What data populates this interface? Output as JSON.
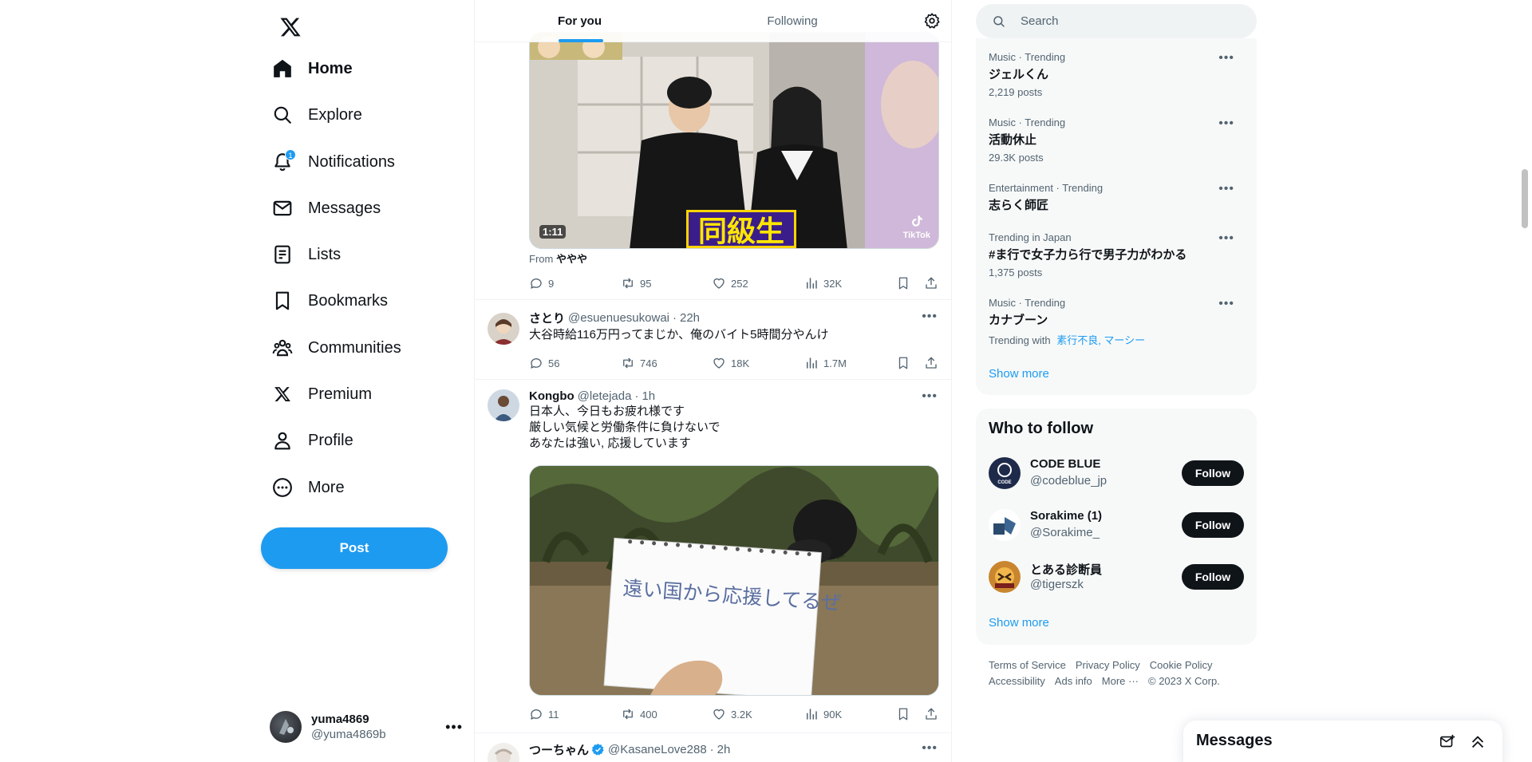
{
  "nav": {
    "items": [
      {
        "label": "Home",
        "icon": "home-icon"
      },
      {
        "label": "Explore",
        "icon": "search-icon"
      },
      {
        "label": "Notifications",
        "icon": "bell-icon",
        "badge": "1"
      },
      {
        "label": "Messages",
        "icon": "envelope-icon"
      },
      {
        "label": "Lists",
        "icon": "list-icon"
      },
      {
        "label": "Bookmarks",
        "icon": "bookmark-icon"
      },
      {
        "label": "Communities",
        "icon": "people-icon"
      },
      {
        "label": "Premium",
        "icon": "x-logo-icon"
      },
      {
        "label": "Profile",
        "icon": "person-icon"
      },
      {
        "label": "More",
        "icon": "more-circle-icon"
      }
    ],
    "post_label": "Post"
  },
  "account": {
    "name": "yuma4869",
    "handle": "@yuma4869b"
  },
  "timeline": {
    "tabs": [
      "For you",
      "Following"
    ],
    "tweets": [
      {
        "video_duration": "1:11",
        "video_caption": "同級生",
        "tiktok_label": "TikTok",
        "from_prefix": "From",
        "from_name": "ややや",
        "replies": "9",
        "retweets": "95",
        "likes": "252",
        "views": "32K"
      },
      {
        "name": "さとり",
        "handle": "@esuenuesukowai",
        "time": "22h",
        "text": "大谷時給116万円ってまじか、俺のバイト5時間分やんけ",
        "replies": "56",
        "retweets": "746",
        "likes": "18K",
        "views": "1.7M"
      },
      {
        "name": "Kongbo",
        "handle": "@letejada",
        "time": "1h",
        "text": "日本人、今日もお疲れ様です\n厳しい気候と労働条件に負けないで\nあなたは強い, 応援しています",
        "image_note_text": "遠い国から応援してるぜ",
        "replies": "11",
        "retweets": "400",
        "likes": "3.2K",
        "views": "90K"
      },
      {
        "name": "つーちゃん",
        "handle": "@KasaneLove288",
        "time": "2h",
        "verified": true
      }
    ]
  },
  "search": {
    "placeholder": "Search"
  },
  "trends": {
    "items": [
      {
        "meta": "Music · Trending",
        "title": "ジェルくん",
        "count": "2,219 posts"
      },
      {
        "meta": "Music · Trending",
        "title": "活動休止",
        "count": "29.3K posts"
      },
      {
        "meta": "Entertainment · Trending",
        "title": "志らく師匠",
        "count": ""
      },
      {
        "meta": "Trending in Japan",
        "title": "#ま行で女子力ら行で男子力がわかる",
        "count": "1,375 posts"
      },
      {
        "meta": "Music · Trending",
        "title": "カナブーン",
        "with_label": "Trending with",
        "with_links": "素行不良, マーシー"
      }
    ],
    "show_more": "Show more"
  },
  "who_to_follow": {
    "title": "Who to follow",
    "accounts": [
      {
        "name": "CODE BLUE",
        "handle": "@codeblue_jp",
        "button": "Follow"
      },
      {
        "name": "Sorakime (1)",
        "handle": "@Sorakime_",
        "button": "Follow"
      },
      {
        "name": "とある診断員",
        "handle": "@tigerszk",
        "button": "Follow"
      }
    ],
    "show_more": "Show more"
  },
  "footer": {
    "links": [
      "Terms of Service",
      "Privacy Policy",
      "Cookie Policy",
      "Accessibility",
      "Ads info",
      "More ···",
      "© 2023 X Corp."
    ]
  },
  "messages_drawer": {
    "title": "Messages"
  },
  "colors": {
    "accent": "#1d9bf0",
    "text": "#0f1419",
    "muted": "#536471",
    "panel": "#f7f9f9"
  }
}
